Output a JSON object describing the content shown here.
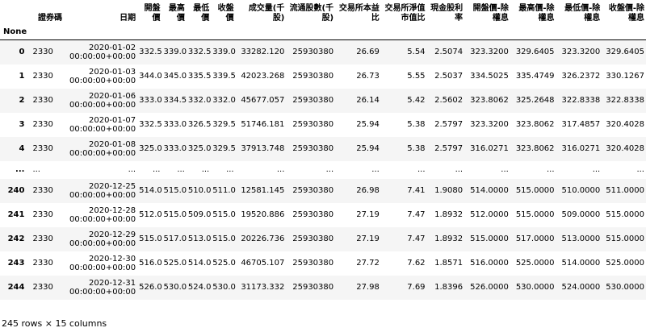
{
  "dataframe": {
    "columns": [
      "證券碼",
      "日期",
      "開盤價",
      "最高價",
      "最低價",
      "收盤價",
      "成交量(千股)",
      "流通股數(千股)",
      "交易所本益比",
      "交易所淨值市值比",
      "現金股利率",
      "開盤價-除權息",
      "最高價-除權息",
      "最低價-除權息",
      "收盤價-除權息"
    ],
    "index_name": "None",
    "rows": [
      {
        "idx": "0",
        "code": "2330",
        "date": "2020-01-02 00:00:00+00:00",
        "open": "332.5",
        "high": "339.0",
        "low": "332.5",
        "close": "339.0",
        "volume": "33282.120",
        "shares": "25930380",
        "pe": "26.69",
        "pb": "5.54",
        "yield": "2.5074",
        "adj_open": "323.3200",
        "adj_high": "329.6405",
        "adj_low": "323.3200",
        "adj_close": "329.6405"
      },
      {
        "idx": "1",
        "code": "2330",
        "date": "2020-01-03 00:00:00+00:00",
        "open": "344.0",
        "high": "345.0",
        "low": "335.5",
        "close": "339.5",
        "volume": "42023.268",
        "shares": "25930380",
        "pe": "26.73",
        "pb": "5.55",
        "yield": "2.5037",
        "adj_open": "334.5025",
        "adj_high": "335.4749",
        "adj_low": "326.2372",
        "adj_close": "330.1267"
      },
      {
        "idx": "2",
        "code": "2330",
        "date": "2020-01-06 00:00:00+00:00",
        "open": "333.0",
        "high": "334.5",
        "low": "332.0",
        "close": "332.0",
        "volume": "45677.057",
        "shares": "25930380",
        "pe": "26.14",
        "pb": "5.42",
        "yield": "2.5602",
        "adj_open": "323.8062",
        "adj_high": "325.2648",
        "adj_low": "322.8338",
        "adj_close": "322.8338"
      },
      {
        "idx": "3",
        "code": "2330",
        "date": "2020-01-07 00:00:00+00:00",
        "open": "332.5",
        "high": "333.0",
        "low": "326.5",
        "close": "329.5",
        "volume": "51746.181",
        "shares": "25930380",
        "pe": "25.94",
        "pb": "5.38",
        "yield": "2.5797",
        "adj_open": "323.3200",
        "adj_high": "323.8062",
        "adj_low": "317.4857",
        "adj_close": "320.4028"
      },
      {
        "idx": "4",
        "code": "2330",
        "date": "2020-01-08 00:00:00+00:00",
        "open": "325.0",
        "high": "333.0",
        "low": "325.0",
        "close": "329.5",
        "volume": "37913.748",
        "shares": "25930380",
        "pe": "25.94",
        "pb": "5.38",
        "yield": "2.5797",
        "adj_open": "316.0271",
        "adj_high": "323.8062",
        "adj_low": "316.0271",
        "adj_close": "320.4028"
      },
      {
        "ellipsis": true,
        "idx": "...",
        "cell": "..."
      },
      {
        "idx": "240",
        "code": "2330",
        "date": "2020-12-25 00:00:00+00:00",
        "open": "514.0",
        "high": "515.0",
        "low": "510.0",
        "close": "511.0",
        "volume": "12581.145",
        "shares": "25930380",
        "pe": "26.98",
        "pb": "7.41",
        "yield": "1.9080",
        "adj_open": "514.0000",
        "adj_high": "515.0000",
        "adj_low": "510.0000",
        "adj_close": "511.0000"
      },
      {
        "idx": "241",
        "code": "2330",
        "date": "2020-12-28 00:00:00+00:00",
        "open": "512.0",
        "high": "515.0",
        "low": "509.0",
        "close": "515.0",
        "volume": "19520.886",
        "shares": "25930380",
        "pe": "27.19",
        "pb": "7.47",
        "yield": "1.8932",
        "adj_open": "512.0000",
        "adj_high": "515.0000",
        "adj_low": "509.0000",
        "adj_close": "515.0000"
      },
      {
        "idx": "242",
        "code": "2330",
        "date": "2020-12-29 00:00:00+00:00",
        "open": "515.0",
        "high": "517.0",
        "low": "513.0",
        "close": "515.0",
        "volume": "20226.736",
        "shares": "25930380",
        "pe": "27.19",
        "pb": "7.47",
        "yield": "1.8932",
        "adj_open": "515.0000",
        "adj_high": "517.0000",
        "adj_low": "513.0000",
        "adj_close": "515.0000"
      },
      {
        "idx": "243",
        "code": "2330",
        "date": "2020-12-30 00:00:00+00:00",
        "open": "516.0",
        "high": "525.0",
        "low": "514.0",
        "close": "525.0",
        "volume": "46705.107",
        "shares": "25930380",
        "pe": "27.72",
        "pb": "7.62",
        "yield": "1.8571",
        "adj_open": "516.0000",
        "adj_high": "525.0000",
        "adj_low": "514.0000",
        "adj_close": "525.0000"
      },
      {
        "idx": "244",
        "code": "2330",
        "date": "2020-12-31 00:00:00+00:00",
        "open": "526.0",
        "high": "530.0",
        "low": "524.0",
        "close": "530.0",
        "volume": "31173.332",
        "shares": "25930380",
        "pe": "27.98",
        "pb": "7.69",
        "yield": "1.8396",
        "adj_open": "526.0000",
        "adj_high": "530.0000",
        "adj_low": "524.0000",
        "adj_close": "530.0000"
      }
    ],
    "shape_note": "245 rows × 15 columns"
  }
}
